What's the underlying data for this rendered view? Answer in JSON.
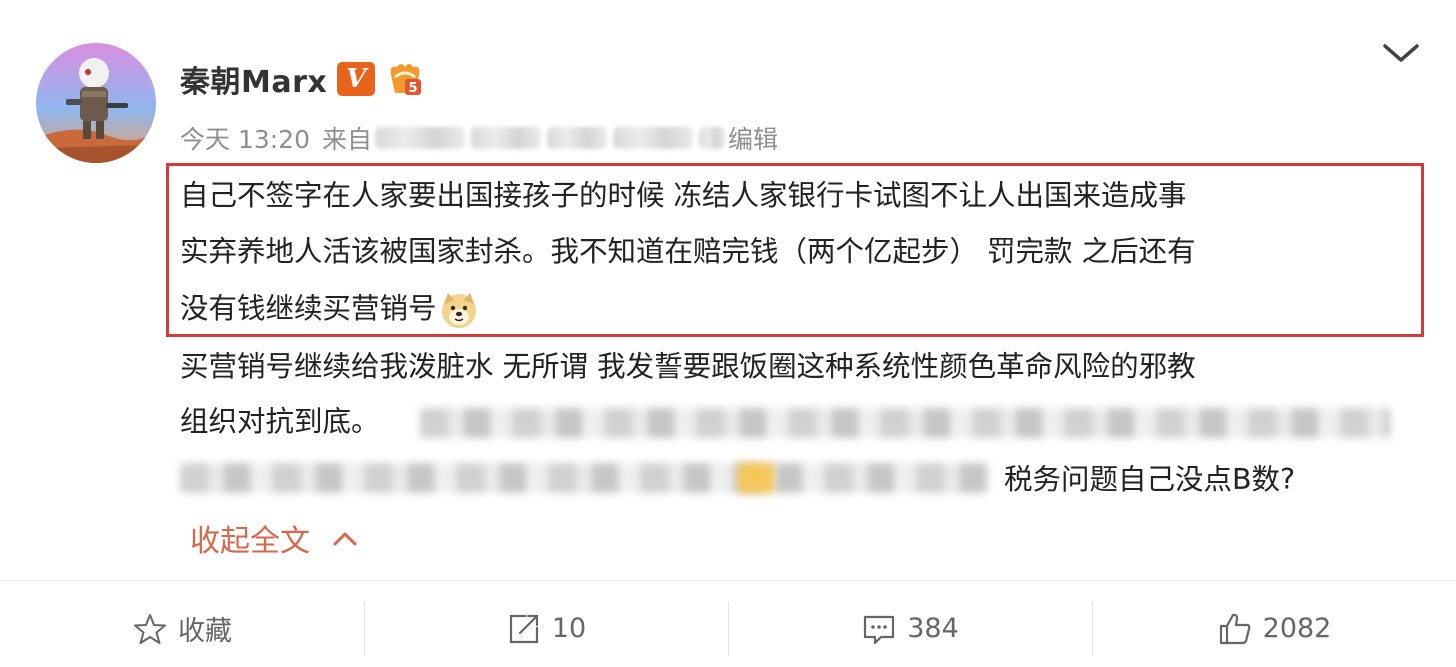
{
  "post": {
    "author_name": "秦朝Marx",
    "vip_badge": "V",
    "level_badge": "5",
    "timestamp": "今天 13:20",
    "source_prefix": "来自",
    "edit_label": "编辑",
    "highlighted_lines": [
      "自己不签字在人家要出国接孩子的时候 冻结人家银行卡试图不让人出国来造成事",
      "实弃养地人活该被国家封杀。我不知道在赔完钱（两个亿起步） 罚完款 之后还有",
      "没有钱继续买营销号"
    ],
    "body_lines": [
      "买营销号继续给我泼脏水 无所谓 我发誓要跟饭圈这种系统性颜色革命风险的邪教",
      "组织对抗到底。"
    ],
    "tail_text": "税务问题自己没点B数?",
    "collapse_label": "收起全文"
  },
  "actions": {
    "favorite_label": "收藏",
    "repost_count": "10",
    "comment_count": "384",
    "like_count": "2082"
  },
  "colors": {
    "highlight_border": "#d33b3b",
    "collapse_link": "#d7664a",
    "vip_orange": "#e8641c"
  },
  "icons": [
    "avatar-image",
    "vip-badge",
    "level-badge",
    "chevron-down-icon",
    "doge-emoji",
    "star-icon",
    "repost-icon",
    "comment-icon",
    "like-icon"
  ]
}
